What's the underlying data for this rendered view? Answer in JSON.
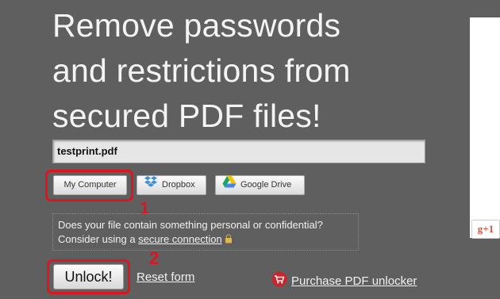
{
  "headline": "Remove passwords\nand restrictions from\nsecured PDF files!",
  "file_field": {
    "value": "testprint.pdf"
  },
  "sources": {
    "my_computer": "My Computer",
    "dropbox": "Dropbox",
    "google_drive": "Google Drive"
  },
  "annotations": {
    "step1": "1",
    "step2": "2",
    "ring_color": "#e0141e"
  },
  "notice": {
    "line1": "Does your file contain something personal or confidential?",
    "line2_prefix": "Consider using a ",
    "link": "secure connection"
  },
  "actions": {
    "unlock": "Unlock!",
    "reset": "Reset form",
    "purchase": "Purchase PDF unlocker"
  },
  "social": {
    "gplus": "g+1"
  },
  "icons": {
    "dropbox": "dropbox-icon",
    "google_drive": "google-drive-icon",
    "lock": "lock-icon",
    "cart": "shopping-cart-icon"
  }
}
